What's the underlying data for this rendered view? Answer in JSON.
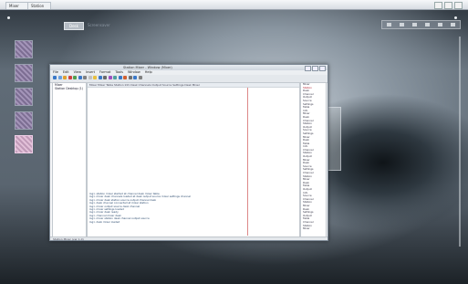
{
  "os_tabs": [
    "Mixer",
    "Station"
  ],
  "desktop": {
    "button": "Desk",
    "label": "Screensaver"
  },
  "app": {
    "title": "Station Mixer - Window (Mixer)",
    "menu": [
      "File",
      "Edit",
      "View",
      "Insert",
      "Format",
      "Tools",
      "Window",
      "Help"
    ],
    "toolbar_colors": [
      "#3a78c8",
      "#6aa0e0",
      "#e0a030",
      "#d04040",
      "#50a050",
      "#3a78c8",
      "#808080",
      "#c0c0c0",
      "#e8c040",
      "#3a78c8",
      "#6a6a6a",
      "#a050c0",
      "#50a0a0",
      "#3a78c8",
      "#d06030",
      "#707070",
      "#3a78c8",
      "#808080"
    ],
    "tree": [
      "Mixer",
      "Station Desktop (1)"
    ],
    "doc_header": "Mixer  Mixer Table   Station Info   Desk Channels   Output   Source   Settings   Desk Mixer",
    "log": [
      "log> station mixer started at channel desk mixer table",
      "log> mixer desk channels loaded at desk output source mixer settings channel",
      "log> mixer desk station source output channel desk",
      "log> desk channel connected at mixer station",
      "log> mixer output source desk channel",
      "log> mixer settings loaded",
      "log> mixer desk ready",
      "log> channel mixer desk",
      "log> mixer station desk channel output source",
      "log> desk mixer loaded"
    ],
    "right_items": [
      "Mixer",
      "Station",
      "Desk",
      "Channel",
      "Output",
      "Source",
      "Settings",
      "Table",
      "Info",
      "Mixer",
      "Desk",
      "Channel",
      "Station",
      "Output",
      "Source",
      "Settings",
      "Mixer",
      "Desk",
      "Table",
      "Info",
      "Channel",
      "Station",
      "Output",
      "Mixer",
      "Desk",
      "Source",
      "Settings",
      "Channel",
      "Station",
      "Mixer",
      "Desk",
      "Table",
      "Output",
      "Info",
      "Source",
      "Channel",
      "Station",
      "Mixer",
      "Desk",
      "Settings",
      "Output",
      "Table",
      "Channel",
      "Station",
      "Mixer"
    ],
    "status": "Station Mixer (ver 1.0)"
  }
}
